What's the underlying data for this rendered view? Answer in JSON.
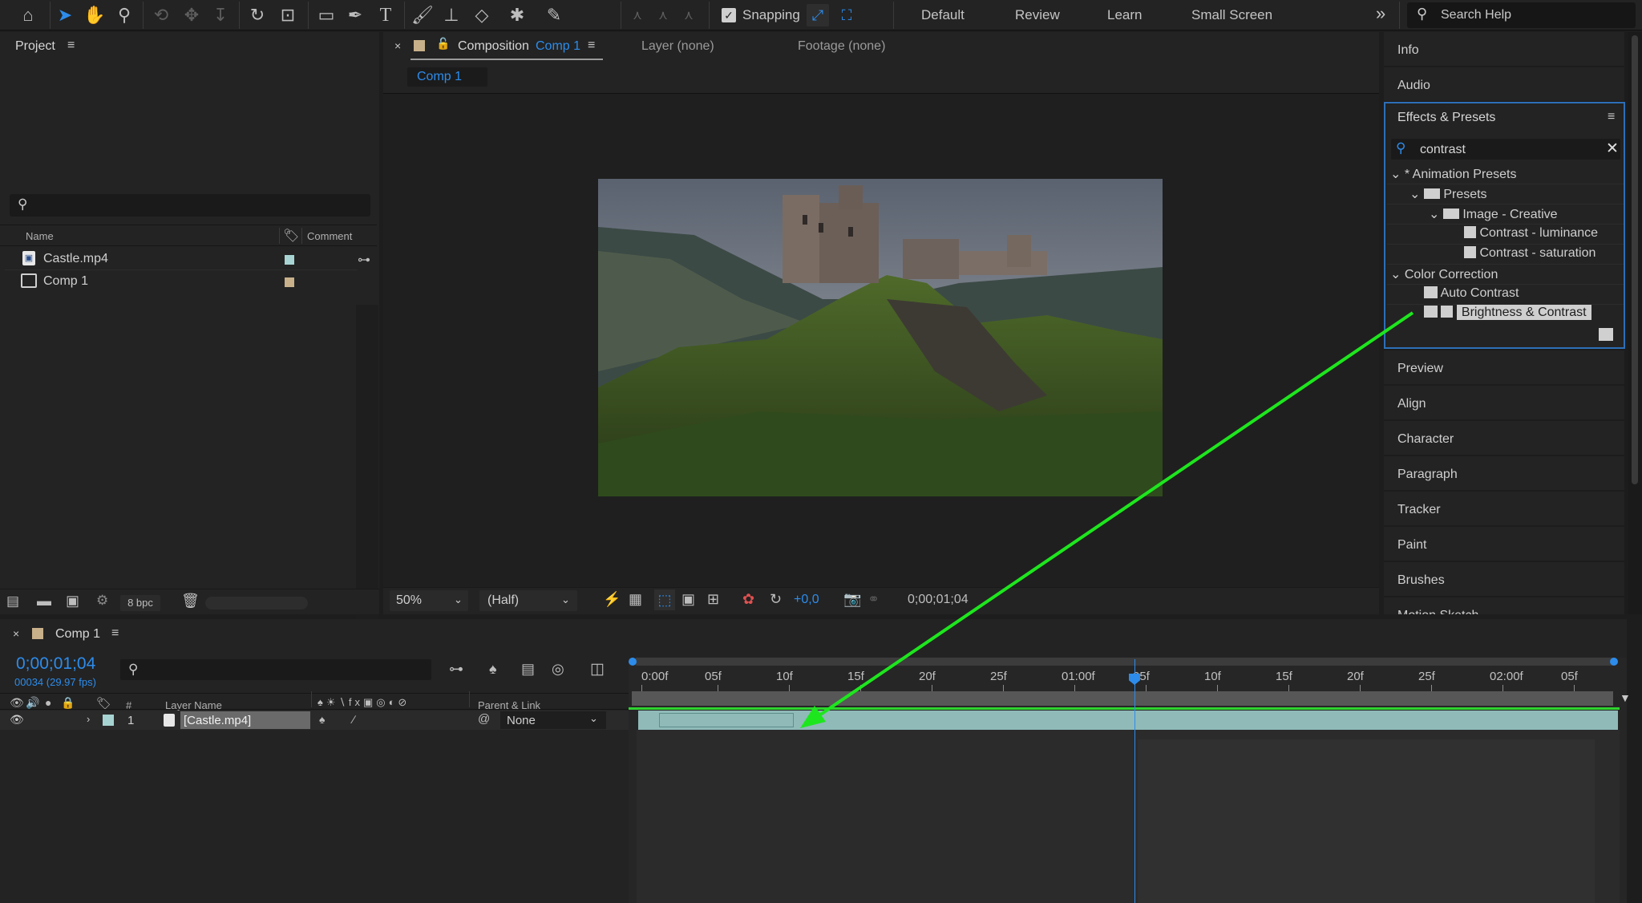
{
  "toolbar": {
    "snapping_label": "Snapping",
    "workspaces": [
      "Default",
      "Review",
      "Learn",
      "Small Screen"
    ],
    "more_label": "»",
    "search_placeholder": "Search Help"
  },
  "project": {
    "title": "Project",
    "search_icon": "search-icon",
    "col_name": "Name",
    "col_comment": "Comment",
    "items": [
      {
        "name": "Castle.mp4",
        "label_color": "#a7d4d2"
      },
      {
        "name": "Comp 1",
        "label_color": "#c8b08a"
      }
    ],
    "bpc": "8 bpc"
  },
  "viewer": {
    "tab_prefix": "Composition",
    "tab_comp": "Comp 1",
    "layer_tab": "Layer (none)",
    "footage_tab": "Footage (none)",
    "comp_chip": "Comp 1",
    "zoom": "50%",
    "resolution": "(Half)",
    "exposure": "+0,0",
    "timecode": "0;00;01;04"
  },
  "right": {
    "info": "Info",
    "audio": "Audio",
    "effects_title": "Effects & Presets",
    "search_value": "contrast",
    "tree": {
      "animation_presets": "* Animation Presets",
      "presets": "Presets",
      "image_creative": "Image - Creative",
      "contrast_luminance": "Contrast - luminance",
      "contrast_saturation": "Contrast - saturation",
      "color_correction": "Color Correction",
      "auto_contrast": "Auto Contrast",
      "brightness_contrast": "Brightness & Contrast"
    },
    "panels": [
      "Preview",
      "Align",
      "Character",
      "Paragraph",
      "Tracker",
      "Paint",
      "Brushes",
      "Motion Sketch"
    ]
  },
  "timeline": {
    "comp_name": "Comp 1",
    "timecode": "0;00;01;04",
    "frame_info": "00034 (29.97 fps)",
    "col_layer_name": "Layer Name",
    "col_number": "#",
    "col_parent": "Parent & Link",
    "layer": {
      "number": "1",
      "name": "[Castle.mp4]",
      "parent": "None",
      "label_color": "#a7d4d2"
    },
    "ticks": [
      "0:00f",
      "05f",
      "10f",
      "15f",
      "20f",
      "25f",
      "01:00f",
      "05f",
      "10f",
      "15f",
      "20f",
      "25f",
      "02:00f",
      "05f"
    ],
    "current_time_fraction": 0.5
  },
  "annotation": {
    "arrow_color": "#1ee61e"
  }
}
